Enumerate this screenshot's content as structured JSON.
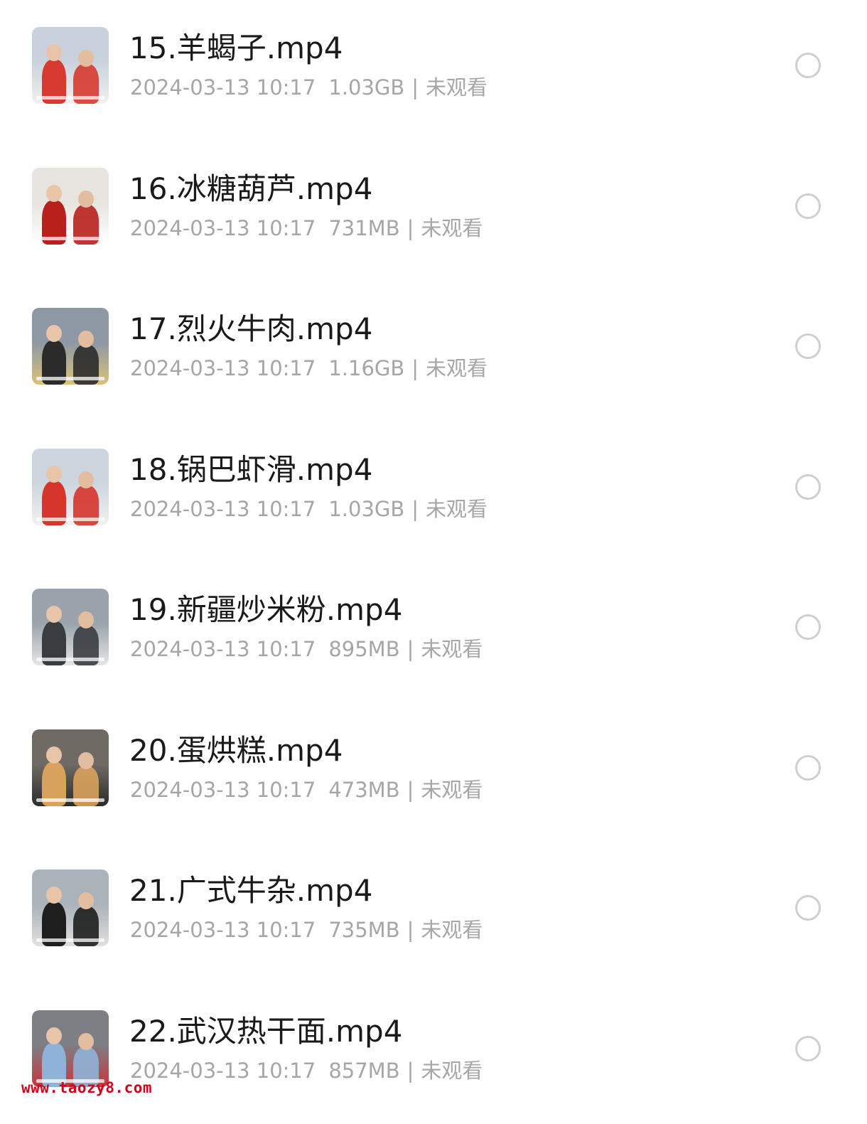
{
  "files": [
    {
      "name": "15.羊蝎子.mp4",
      "date": "2024-03-13 10:17",
      "size": "1.03GB",
      "separator": "|",
      "status": "未观看",
      "thumb_colors": [
        "#c9d2dc",
        "#d73a2e",
        "#f1f1f1"
      ]
    },
    {
      "name": "16.冰糖葫芦.mp4",
      "date": "2024-03-13 10:17",
      "size": "731MB",
      "separator": "|",
      "status": "未观看",
      "thumb_colors": [
        "#e8e4e0",
        "#b8201c",
        "#ffffff"
      ]
    },
    {
      "name": "17.烈火牛肉.mp4",
      "date": "2024-03-13 10:17",
      "size": "1.16GB",
      "separator": "|",
      "status": "未观看",
      "thumb_colors": [
        "#8e98a4",
        "#2b2b2b",
        "#d9c27a"
      ]
    },
    {
      "name": "18.锅巴虾滑.mp4",
      "date": "2024-03-13 10:17",
      "size": "1.03GB",
      "separator": "|",
      "status": "未观看",
      "thumb_colors": [
        "#cdd5de",
        "#d6352b",
        "#f2f2f2"
      ]
    },
    {
      "name": "19.新疆炒米粉.mp4",
      "date": "2024-03-13 10:17",
      "size": "895MB",
      "separator": "|",
      "status": "未观看",
      "thumb_colors": [
        "#9aa3ab",
        "#3a3d40",
        "#e6e6e6"
      ]
    },
    {
      "name": "20.蛋烘糕.mp4",
      "date": "2024-03-13 10:17",
      "size": "473MB",
      "separator": "|",
      "status": "未观看",
      "thumb_colors": [
        "#6f6a63",
        "#d9a25c",
        "#2c2c2c"
      ]
    },
    {
      "name": "21.广式牛杂.mp4",
      "date": "2024-03-13 10:17",
      "size": "735MB",
      "separator": "|",
      "status": "未观看",
      "thumb_colors": [
        "#aab2ba",
        "#1e1e1e",
        "#e0e0e0"
      ]
    },
    {
      "name": "22.武汉热干面.mp4",
      "date": "2024-03-13 10:17",
      "size": "857MB",
      "separator": "|",
      "status": "未观看",
      "thumb_colors": [
        "#7d7f84",
        "#8fb2d8",
        "#c8373b"
      ]
    }
  ],
  "watermark": "www.taozy8.com"
}
